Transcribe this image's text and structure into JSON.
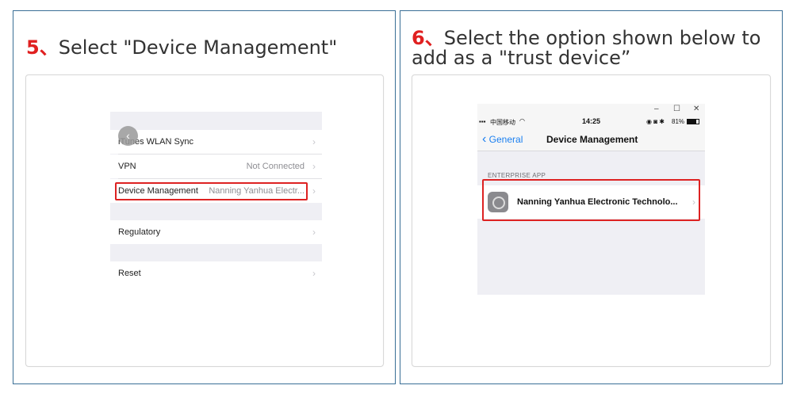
{
  "left": {
    "step_number": "5、",
    "step_text": "Select \"Device Management\"",
    "rows": [
      {
        "label": "iTunes WLAN Sync",
        "value": ""
      },
      {
        "label": "VPN",
        "value": "Not Connected"
      },
      {
        "label": "Device Management",
        "value": "Nanning Yanhua Electr..."
      },
      {
        "label": "Regulatory",
        "value": ""
      },
      {
        "label": "Reset",
        "value": ""
      }
    ],
    "chevron": "›",
    "back_icon": "‹"
  },
  "right": {
    "step_number": "6、",
    "step_line1": "Select the option shown below to",
    "step_line2": "add as a \"trust device”",
    "window_controls": [
      "–",
      "☐",
      "✕"
    ],
    "status": {
      "carrier": "中国移动",
      "time": "14:25",
      "battery": "81%"
    },
    "nav": {
      "back_label": "General",
      "title": "Device Management"
    },
    "section_header": "ENTERPRISE APP",
    "app_name": "Nanning Yanhua Electronic Technolo...",
    "chevron": "›"
  },
  "colors": {
    "accent_red": "#e02020",
    "border_blue": "#3a6f96",
    "ios_blue": "#1a7ff0"
  }
}
